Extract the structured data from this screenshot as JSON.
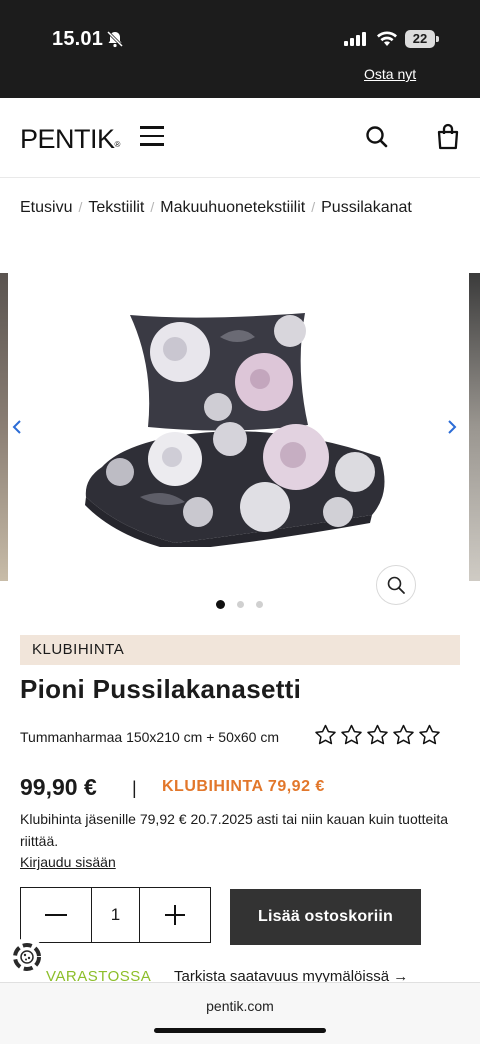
{
  "status_bar": {
    "time": "15.01",
    "battery": "22"
  },
  "promo": {
    "link": "Osta nyt"
  },
  "header": {
    "logo": "PENTIK",
    "logo_mark": "®"
  },
  "breadcrumb": [
    "Etusivu",
    "Tekstiilit",
    "Makuuhuonetekstiilit",
    "Pussilakanat"
  ],
  "gallery": {
    "slide_count": 3,
    "active_index": 0
  },
  "product": {
    "badge": "KLUBIHINTA",
    "title": "Pioni Pussilakanasetti",
    "variant": "Tummanharmaa 150x210 cm + 50x60 cm",
    "rating_stars": 5,
    "price": "99,90 €",
    "separator": "|",
    "club_price": "KLUBIHINTA 79,92 €",
    "club_note": "Klubihinta jäsenille 79,92 € 20.7.2025 asti tai niin kauan kuin tuotteita riittää.",
    "login_link": "Kirjaudu sisään",
    "quantity": "1",
    "add_to_cart": "Lisää ostoskoriin",
    "stock_status": "VARASTOSSA",
    "check_stores": "Tarkista saatavuus myymälöissä →"
  },
  "browser": {
    "url": "pentik.com"
  },
  "colors": {
    "accent_orange": "#e2772b",
    "stock_green": "#8cbe2a",
    "banner_bg": "#f1e5da",
    "button_dark": "#333333"
  }
}
